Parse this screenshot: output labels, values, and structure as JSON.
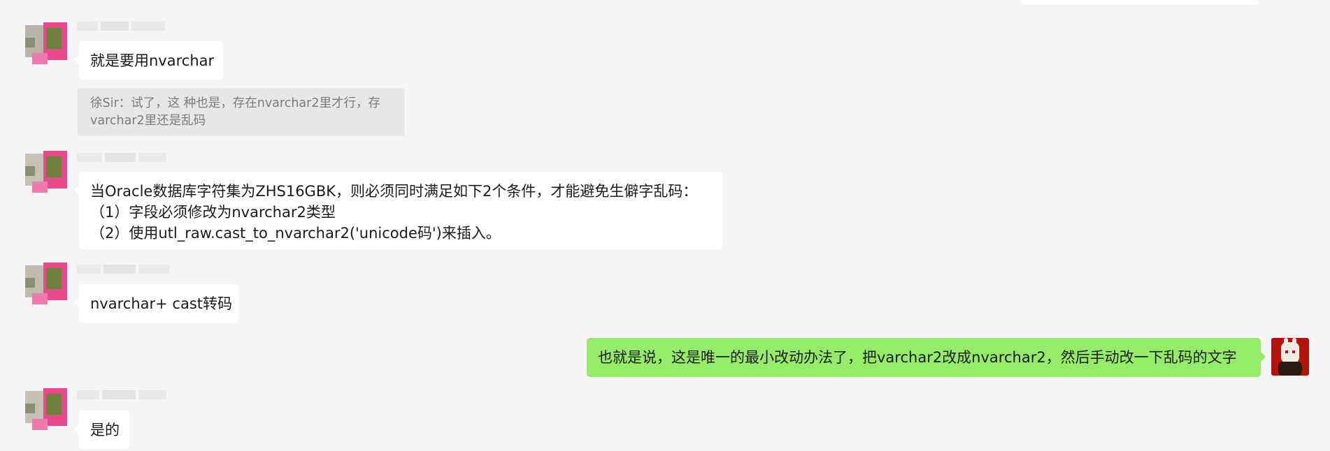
{
  "messages": {
    "m1": {
      "text": "就是要用nvarchar"
    },
    "quote": {
      "line1": "徐Sir：试了，这 种也是，存在nvarchar2里才行，存",
      "line2": "varchar2里还是乱码"
    },
    "m2": {
      "line1": "当Oracle数据库字符集为ZHS16GBK，则必须同时满足如下2个条件，才能避免生僻字乱码：",
      "line2": "（1）字段必须修改为nvarchar2类型",
      "line3": "（2）使用utl_raw.cast_to_nvarchar2('unicode码')来插入。"
    },
    "m3": {
      "text": "nvarchar+ cast转码"
    },
    "m4": {
      "text": "也就是说，这是唯一的最小改动办法了，把varchar2改成nvarchar2，然后手动改一下乱码的文字"
    },
    "m5": {
      "text": "是的"
    }
  },
  "avatars": {
    "left": "pixelated-flower-avatar",
    "right": "rabbit-avatar"
  },
  "colors": {
    "background": "#f5f5f5",
    "incoming_bubble": "#ffffff",
    "outgoing_bubble": "#95ec69",
    "quote_bg": "#e7e7e7",
    "quote_text": "#7b7b7b"
  }
}
